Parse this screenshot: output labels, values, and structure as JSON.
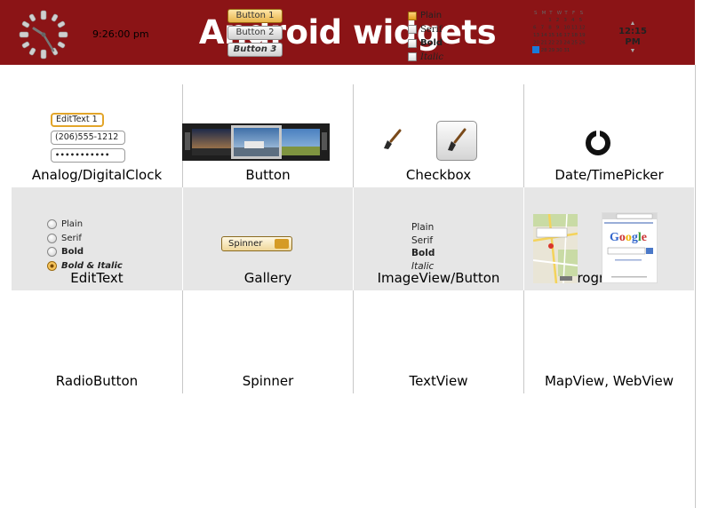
{
  "header": {
    "title": "Android widgets",
    "bg_color": "#8b1416"
  },
  "rows": [
    {
      "cells": [
        {
          "caption": "Analog/DigitalClock"
        },
        {
          "caption": "Button"
        },
        {
          "caption": "Checkbox"
        },
        {
          "caption": "Date/TimePicker"
        }
      ]
    },
    {
      "cells": [
        {
          "caption": "EditText"
        },
        {
          "caption": "Gallery"
        },
        {
          "caption": "ImageView/Button"
        },
        {
          "caption": "ProgressBar"
        }
      ]
    },
    {
      "cells": [
        {
          "caption": "RadioButton"
        },
        {
          "caption": "Spinner"
        },
        {
          "caption": "TextView"
        },
        {
          "caption": "MapView, WebView"
        }
      ]
    }
  ],
  "clock": {
    "digital_time": "9:26:00 pm"
  },
  "buttons": [
    "Button 1",
    "Button 2",
    "Button 3"
  ],
  "checkboxes": [
    {
      "label": "Plain",
      "checked": true
    },
    {
      "label": "Serif",
      "checked": false
    },
    {
      "label": "Bold",
      "checked": false
    },
    {
      "label": "Italic",
      "checked": false
    }
  ],
  "date_picker": {
    "weekday_headers": [
      "S",
      "M",
      "T",
      "W",
      "T",
      "F",
      "S"
    ],
    "weeks": [
      [
        "",
        "",
        "1",
        "2",
        "3",
        "4",
        "5"
      ],
      [
        "6",
        "7",
        "8",
        "9",
        "10",
        "11",
        "12"
      ],
      [
        "13",
        "14",
        "15",
        "16",
        "17",
        "18",
        "19"
      ],
      [
        "20",
        "21",
        "22",
        "23",
        "24",
        "25",
        "26"
      ],
      [
        "27",
        "28",
        "29",
        "30",
        "31",
        "",
        ""
      ]
    ],
    "selected_day": "27"
  },
  "time_picker": {
    "value": "12:15 PM"
  },
  "edit_texts": [
    {
      "value": "EditText 1",
      "focused": true
    },
    {
      "value": "(206)555-1212",
      "focused": false
    },
    {
      "value": "•••••••••••",
      "focused": false
    }
  ],
  "radio_buttons": [
    {
      "label": "Plain",
      "checked": false
    },
    {
      "label": "Serif",
      "checked": false
    },
    {
      "label": "Bold",
      "checked": false
    },
    {
      "label": "Bold & Italic",
      "checked": true
    }
  ],
  "spinner": {
    "value": "Spinner"
  },
  "text_views": [
    "Plain",
    "Serif",
    "Bold",
    "Italic"
  ],
  "colors": {
    "accent": "#e2a52a",
    "shaded_row": "#e6e6e6"
  }
}
